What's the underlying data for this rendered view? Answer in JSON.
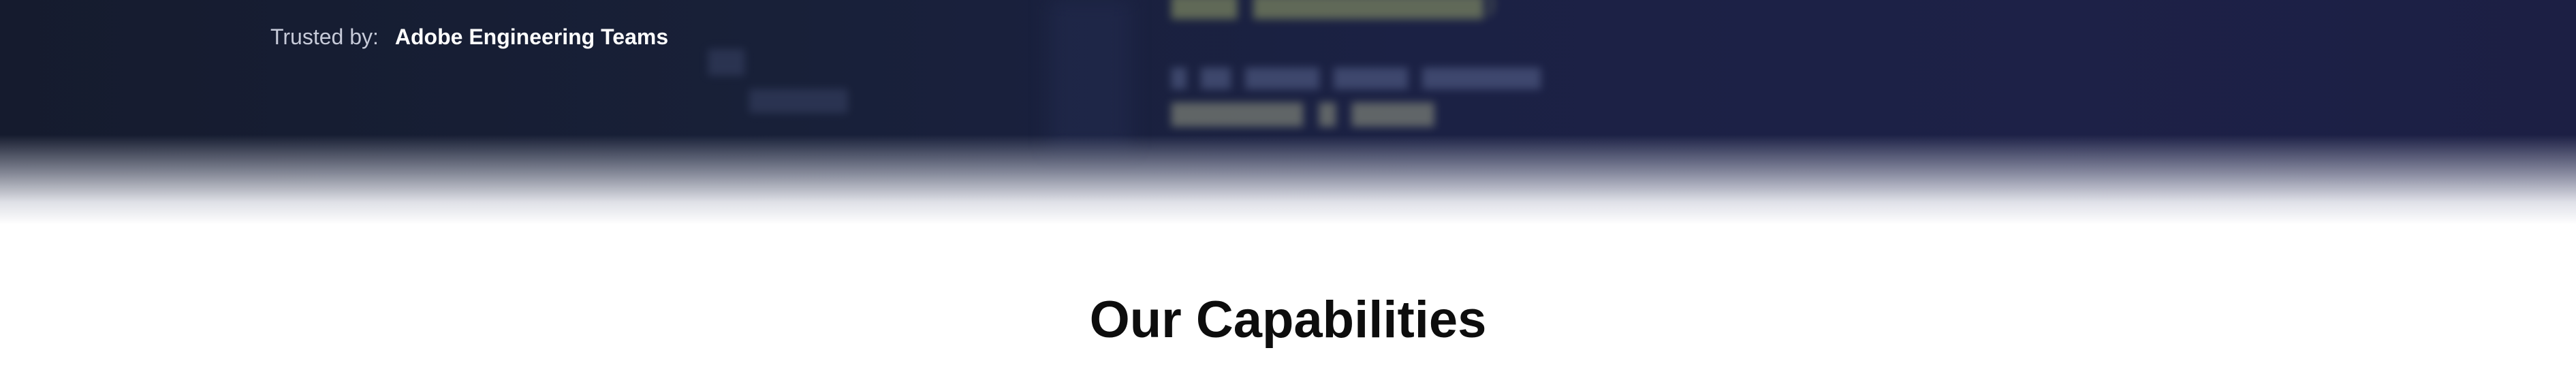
{
  "hero": {
    "trusted_label": "Trusted by:",
    "trusted_value": "Adobe Engineering Teams",
    "background_colors": [
      "#151b2e",
      "#1d2147"
    ]
  },
  "capabilities": {
    "title": "Our Capabilities"
  }
}
